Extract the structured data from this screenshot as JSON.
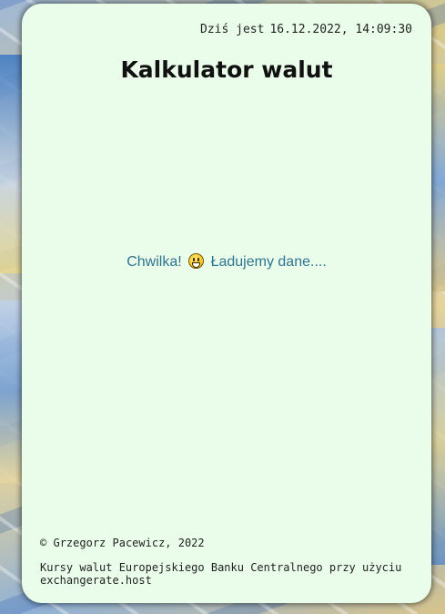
{
  "header": {
    "date_label": "Dziś jest",
    "datetime": "16.12.2022, 14:09:30"
  },
  "page": {
    "title": "Kalkulator walut"
  },
  "loading": {
    "prefix": "Chwilka!",
    "emoji": "grinning-face-icon",
    "message": "Ładujemy dane...."
  },
  "footer": {
    "copyright_symbol": "©",
    "author": "Grzegorz Pacewicz, 2022",
    "attribution": "Kursy walut Europejskiego Banku Centralnego przy użyciu exchangerate.host"
  },
  "colors": {
    "card_background": "#eafdea",
    "loading_text": "#2f7490",
    "title_text": "#111111"
  }
}
